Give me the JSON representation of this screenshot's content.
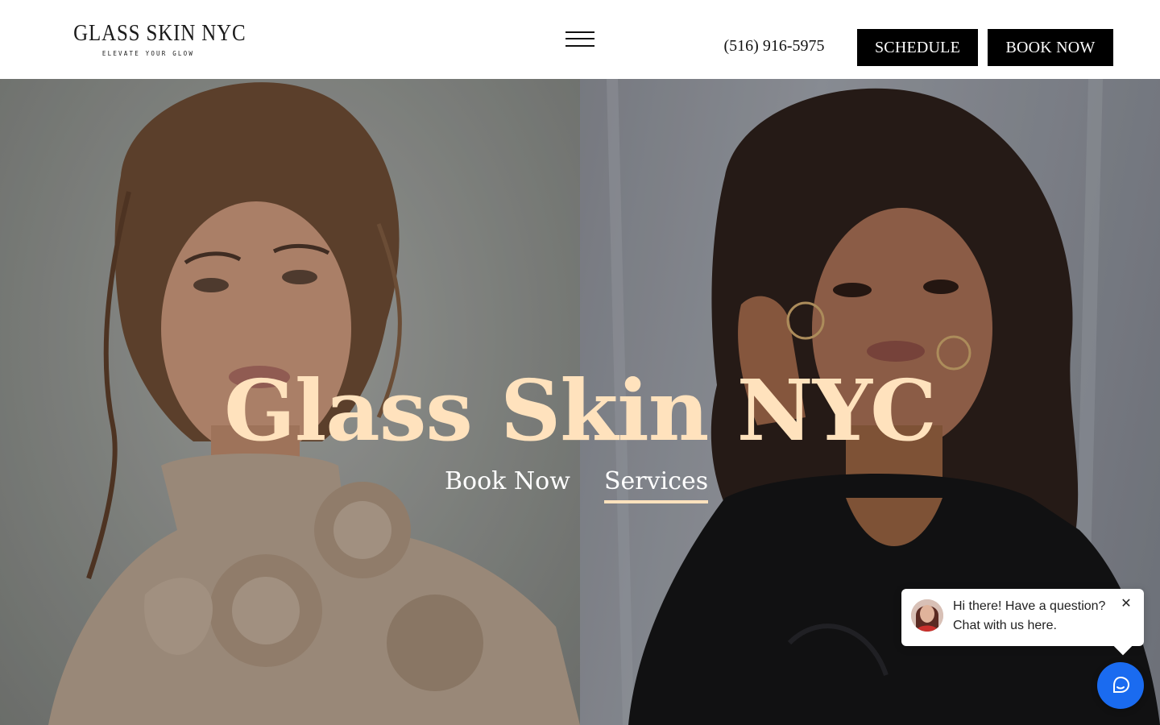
{
  "header": {
    "logo_main": "GLASS SKIN NYC",
    "logo_tagline": "ELEVATE YOUR GLOW",
    "menu_icon": "hamburger-menu-icon",
    "phone": "(516) 916-5975",
    "schedule_label": "SCHEDULE",
    "book_now_label": "BOOK NOW"
  },
  "hero": {
    "title": "Glass Skin NYC",
    "links": [
      {
        "label": "Book Now",
        "active": false
      },
      {
        "label": "Services",
        "active": true
      }
    ],
    "title_color": "#ffe2bd",
    "underline_color": "#ffe2bd"
  },
  "chat": {
    "message": "Hi there! Have a question? Chat with us here.",
    "close_icon": "close-icon",
    "launcher_icon": "chat-bubble-icon",
    "launcher_color": "#1a6bf0"
  },
  "colors": {
    "header_bg": "#ffffff",
    "button_bg": "#000000",
    "button_text": "#ffffff"
  }
}
